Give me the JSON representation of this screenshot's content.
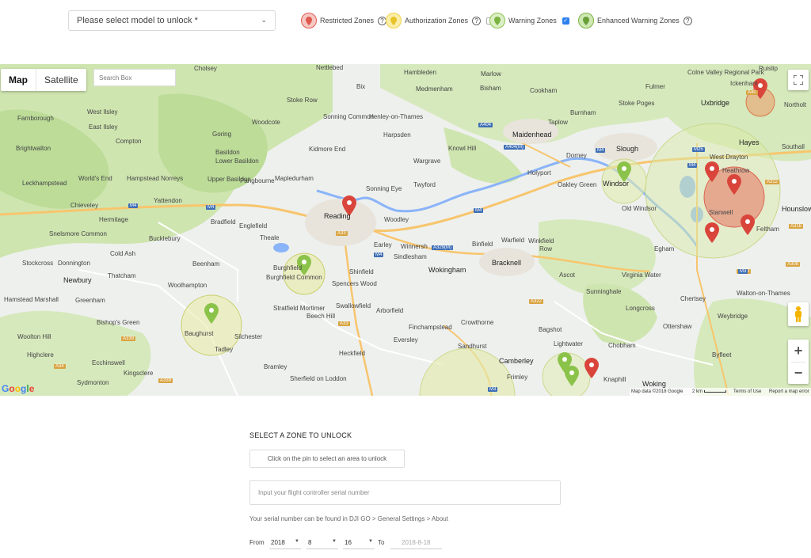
{
  "toolbar": {
    "model_select_placeholder": "Please select model to unlock *",
    "legend": {
      "restricted": "Restricted Zones",
      "authorization": "Authorization Zones",
      "warning": "Warning Zones",
      "enhanced_warning": "Enhanced Warning Zones"
    },
    "warning_checked": false,
    "enhanced_warning_checked": true,
    "colors": {
      "restricted": "#e05a4f",
      "authorization": "#f1d24a",
      "warning": "#8bc34a",
      "enhanced": "#7cb342"
    }
  },
  "map": {
    "type_buttons": [
      "Map",
      "Satellite"
    ],
    "active_type": "Map",
    "search_placeholder": "Search Box",
    "zoom_in": "+",
    "zoom_out": "−",
    "attribution": {
      "data": "Map data ©2018 Google",
      "scale": "2 km",
      "terms": "Terms of Use",
      "report": "Report a map error"
    },
    "google": "Google",
    "towns": [
      "Cholsey",
      "Nettlebed",
      "Hambleden",
      "Marlow",
      "Bix",
      "Medmenham",
      "Bisham",
      "Cookham",
      "Ruislip",
      "Colne Valley Regional Park",
      "Fulmer",
      "Ickenham",
      "Farnborough",
      "West Ilsley",
      "Stoke Row",
      "Henley-on-Thames",
      "Burnham",
      "Stoke Poges",
      "Uxbridge",
      "Northolt",
      "East Ilsley",
      "Woodcote",
      "Sonning Common",
      "Harpsden",
      "Taplow",
      "Goring",
      "Maidenhead",
      "Hayes",
      "Brightwalton",
      "Compton",
      "Kidmore End",
      "Knowl Hill",
      "Slough",
      "West Drayton",
      "Southall",
      "Basildon",
      "Lower Basildon",
      "Wargrave",
      "Dorney",
      "Heathrow",
      "World's End",
      "Hampstead Norreys",
      "Upper Basildon",
      "Pangbourne",
      "Mapledurham",
      "Twyford",
      "Holyport",
      "Oakley Green",
      "Windsor",
      "Leckhampstead",
      "Sonning Eye",
      "Yattendon",
      "Chieveley",
      "Hermitage",
      "Reading",
      "Woodley",
      "Old Windsor",
      "Stanwell",
      "Hounslow",
      "Bradfield",
      "Englefield",
      "Feltham",
      "Snelsmore Common",
      "Bucklebury",
      "Theale",
      "Earley",
      "Winnersh",
      "Binfield",
      "Warfield",
      "Winkfield",
      "Cold Ash",
      "Sindlesham",
      "Row",
      "Stockcross",
      "Donnington",
      "Beenham",
      "Burghfield",
      "Shinfield",
      "Wokingham",
      "Bracknell",
      "Egham",
      "Thatcham",
      "Burghfield Common",
      "Spencers Wood",
      "Ascot",
      "Virginia Water",
      "Newbury",
      "Woolhampton",
      "Swallowfield",
      "Sunninghale",
      "Longcross",
      "Chertsey",
      "Walton-on-Thames",
      "Hamstead Marshall",
      "Greenham",
      "Stratfield Mortimer",
      "Beech Hill",
      "Weybridge",
      "Bishop's Green",
      "Baughurst",
      "Silchester",
      "Finchampstead",
      "Crowthorne",
      "Bagshot",
      "Ottershaw",
      "Woolton Hill",
      "Tadley",
      "Arborfield",
      "Eversley",
      "Lightwater",
      "Chobham",
      "Highclere",
      "Ecchinswell",
      "Heckfield",
      "Sandhurst",
      "Camberley",
      "Byfleet",
      "Kingsclere",
      "Bramley",
      "Frimley",
      "Knaphill",
      "Sydmonton",
      "Sherfield on Loddon",
      "Woking"
    ]
  },
  "form": {
    "section_title": "SELECT A ZONE TO UNLOCK",
    "pin_button": "Click on the pin to select an area to unlock",
    "serial_placeholder": "Input your flight controller serial number",
    "serial_hint": "Your serial number can be found in DJI GO > General Settings > About",
    "from_label": "From",
    "year": "2018",
    "month": "8",
    "day": "16",
    "to_label": "To",
    "to_date": "2018-8-18"
  }
}
